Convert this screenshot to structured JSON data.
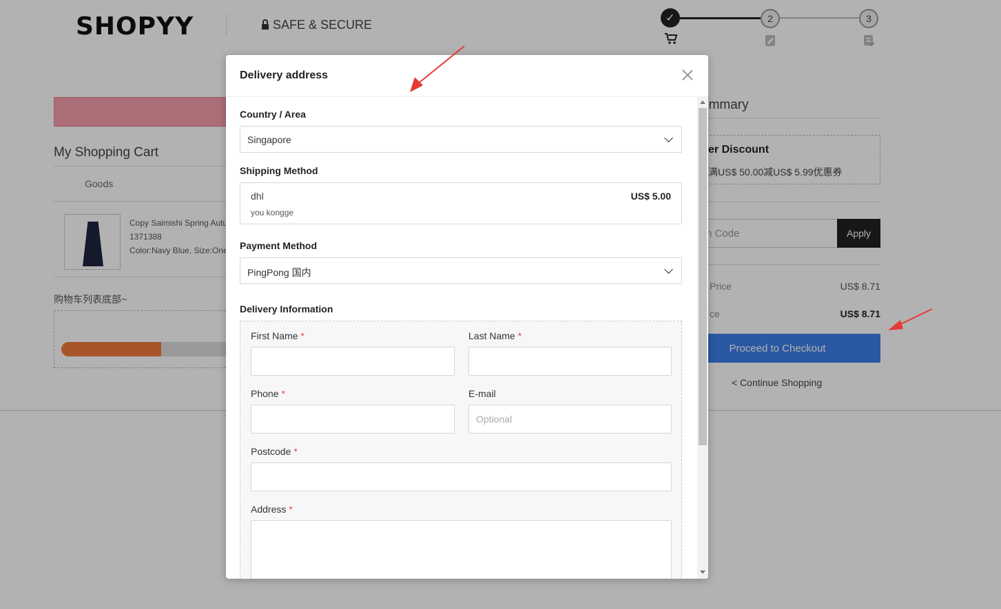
{
  "header": {
    "logo": "SHOPYY",
    "secure": "SAFE & SECURE",
    "steps": [
      "2",
      "3"
    ]
  },
  "cart": {
    "title": "My Shopping Cart",
    "goods_header": "Goods",
    "item": {
      "name": "Copy Saimishi Spring Autu",
      "sku": "1371388",
      "variant": "Color:Navy Blue, Size:One"
    },
    "footer_note": "购物车列表底部~",
    "progress": 0.58
  },
  "summary": {
    "title": "ummary",
    "discount_title": "er Discount",
    "discount_desc": "满US$ 50.00减US$ 5.99优惠券",
    "coupon_placeholder": "n Code",
    "apply_label": "Apply",
    "price_label": "Price",
    "price_value": "US$ 8.71",
    "total_label": "ce",
    "total_value": "US$ 8.71",
    "checkout_label": "Proceed to Checkout",
    "continue_label": "< Continue Shopping"
  },
  "modal": {
    "title": "Delivery address",
    "country_label": "Country / Area",
    "country_value": "Singapore",
    "shipping_label": "Shipping Method",
    "shipping": {
      "name": "dhl",
      "price": "US$ 5.00",
      "desc": "you kongge"
    },
    "payment_label": "Payment Method",
    "payment_value": "PingPong 国内",
    "delivery_label": "Delivery Information",
    "fields": {
      "first_name": "First Name",
      "last_name": "Last Name",
      "phone": "Phone",
      "email": "E-mail",
      "email_placeholder": "Optional",
      "postcode": "Postcode",
      "address": "Address",
      "required_mark": "*"
    }
  },
  "colors": {
    "accent": "#3d7ee8",
    "annotation": "#e53935",
    "progress": "#f07c3c"
  }
}
